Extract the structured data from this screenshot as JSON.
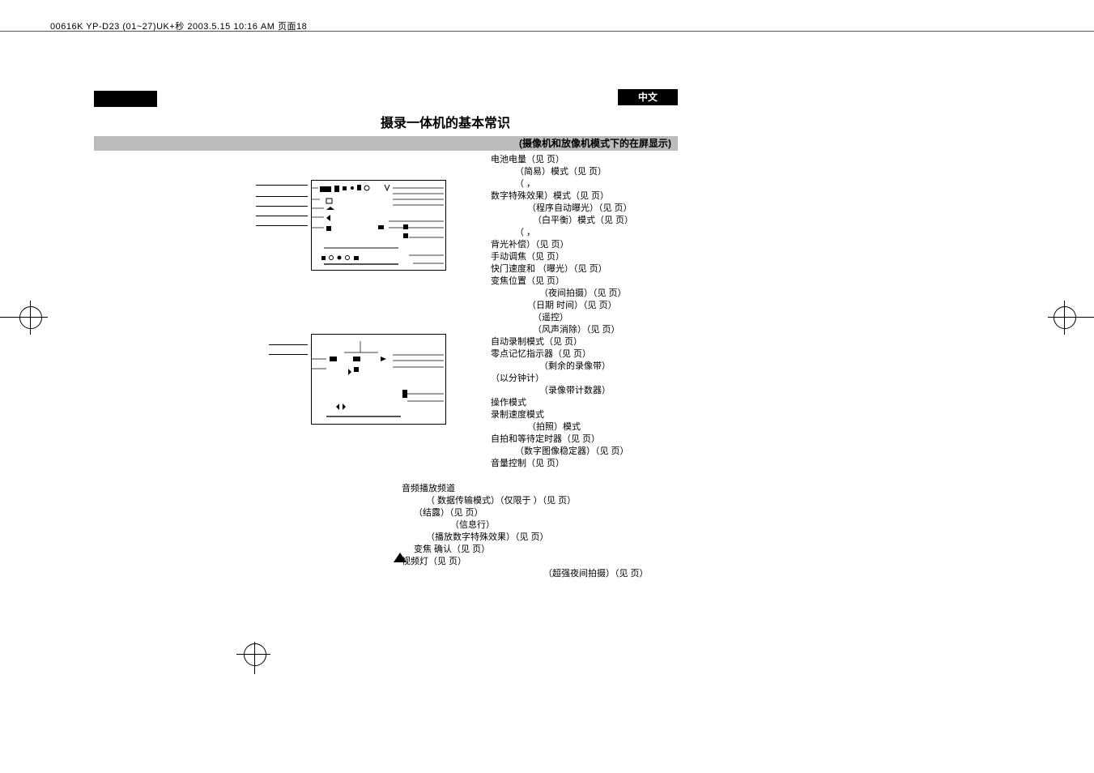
{
  "headerStrip": "00616K YP-D23 (01~27)UK+秒 2003.5.15 10:16 AM 页面18",
  "langLabel": "中文",
  "title": "摄录一体机的基本常识",
  "greyBar": "(摄像机和放像机模式下的在屏显示)",
  "callouts": [
    {
      "text": "电池电量（见 页）",
      "cls": ""
    },
    {
      "text": "（简易）模式（见 页）",
      "cls": "ind30"
    },
    {
      "text": "（                      ，",
      "cls": "ind30"
    },
    {
      "text": "数字特殊效果）模式（见 页）",
      "cls": ""
    },
    {
      "text": "（程序自动曝光）（见 页）",
      "cls": "ind45"
    },
    {
      "text": "（白平衡）模式（见 页）",
      "cls": "ind52"
    },
    {
      "text": "（                             ，",
      "cls": "ind30"
    },
    {
      "text": "背光补偿）（见 页）",
      "cls": ""
    },
    {
      "text": "手动调焦（见 页）",
      "cls": ""
    },
    {
      "text": "快门速度和             （曝光）（见 页）",
      "cls": ""
    },
    {
      "text": "变焦位置（见 页）",
      "cls": ""
    },
    {
      "text": "（夜间拍摄）（见 页）",
      "cls": "ind60"
    },
    {
      "text": "（日期 时间）（见 页）",
      "cls": "ind45"
    },
    {
      "text": " ",
      "cls": ""
    },
    {
      "text": "（遥控）",
      "cls": "ind52"
    },
    {
      "text": "（风声消除）（见 页）",
      "cls": "ind52"
    },
    {
      "text": "自动录制模式（见 页）",
      "cls": ""
    },
    {
      "text": "零点记忆指示器（见 页）",
      "cls": ""
    },
    {
      "text": "（剩余的录像带）",
      "cls": "ind60"
    },
    {
      "text": "（以分钟计）",
      "cls": ""
    },
    {
      "text": "（录像带计数器）",
      "cls": "ind60"
    },
    {
      "text": "操作模式",
      "cls": ""
    },
    {
      "text": "录制速度模式",
      "cls": ""
    },
    {
      "text": "（拍照）模式",
      "cls": "ind45"
    },
    {
      "text": "自拍和等待定时器（见 页）",
      "cls": ""
    },
    {
      "text": "（数字图像稳定器）（见 页）",
      "cls": "ind30"
    },
    {
      "text": "音量控制（见 页）",
      "cls": ""
    }
  ],
  "extra": [
    {
      "text": "音频播放频道",
      "cls": ""
    },
    {
      "text": "（    数据传输模式）（仅限于               ）（见 页）",
      "cls": "ind30"
    },
    {
      "text": "（结露）（见 页）",
      "cls": "ind15"
    },
    {
      "text": "（信息行）",
      "cls": "ind60"
    },
    {
      "text": "（播放数字特殊效果）（见 页）",
      "cls": "ind30"
    },
    {
      "text": "变焦 确认（见 页）",
      "cls": "ind15"
    },
    {
      "text": "视频灯（见 页）",
      "cls": ""
    },
    {
      "text": "（超强夜间拍摄）（见 页）",
      "cls": "",
      "style": "padding-left:175px;"
    }
  ]
}
